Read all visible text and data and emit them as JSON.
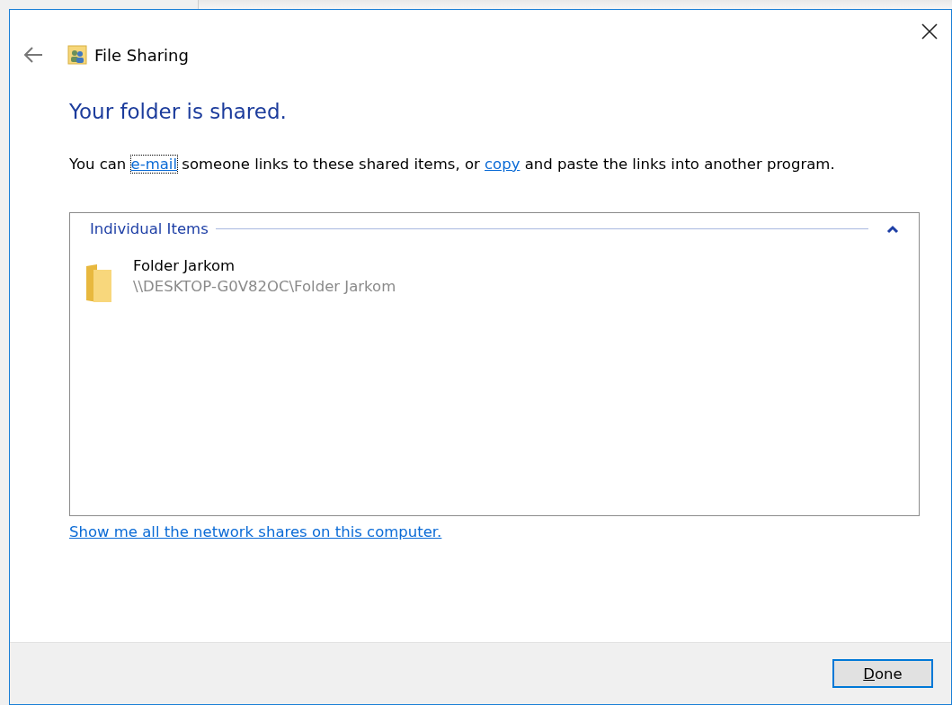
{
  "window": {
    "title": "File Sharing"
  },
  "heading": "Your folder is shared.",
  "message": [
    {
      "kind": "text",
      "text": "You can "
    },
    {
      "kind": "link",
      "text": "e-mail",
      "focused": true
    },
    {
      "kind": "text",
      "text": " someone links to these shared items, or "
    },
    {
      "kind": "link",
      "text": "copy",
      "focused": false
    },
    {
      "kind": "text",
      "text": " and paste the links into another program."
    }
  ],
  "group": {
    "title": "Individual Items",
    "expanded": true,
    "items": [
      {
        "name": "Folder Jarkom",
        "path": "\\\\DESKTOP-G0V82OC\\Folder Jarkom"
      }
    ]
  },
  "footer_link": "Show me all the network shares on this computer.",
  "buttons": [
    {
      "label": "Done",
      "mnemonic_underlined": true,
      "default": true
    }
  ]
}
